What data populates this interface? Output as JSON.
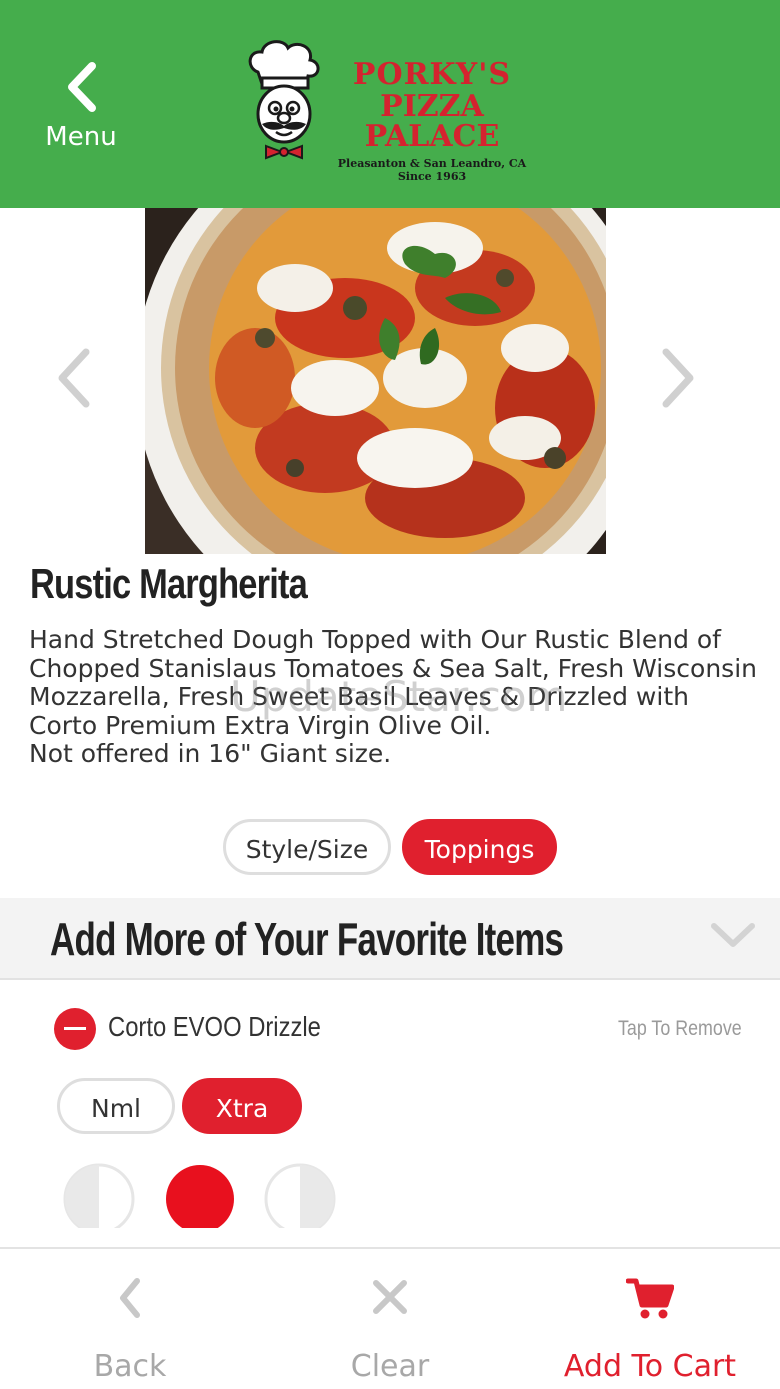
{
  "header": {
    "menu_label": "Menu",
    "logo": {
      "line1": "PORKY'S",
      "line2": "PIZZA PALACE",
      "line3": "Pleasanton & San Leandro, CA",
      "line4": "Since 1963"
    }
  },
  "item": {
    "title": "Rustic Margherita",
    "description": "Hand Stretched Dough Topped with Our Rustic Blend of Chopped Stanislaus Tomatoes & Sea Salt, Fresh Wisconsin Mozzarella, Fresh Sweet Basil Leaves & Drizzled with Corto Premium Extra Virgin Olive Oil.",
    "note": "Not offered in 16\" Giant size."
  },
  "watermark": "UpdateStar.com",
  "option_tabs": [
    {
      "label": "Style/Size",
      "active": false
    },
    {
      "label": "Toppings",
      "active": true
    }
  ],
  "section": {
    "title": "Add More of Your Favorite Items"
  },
  "topping": {
    "name": "Corto EVOO Drizzle",
    "action": "Tap To Remove",
    "amounts": [
      {
        "label": "Nml",
        "selected": false
      },
      {
        "label": "Xtra",
        "selected": true
      }
    ],
    "portions": [
      "left-half",
      "whole",
      "right-half"
    ],
    "selected_portion": "whole"
  },
  "bottom_bar": {
    "back_label": "Back",
    "clear_label": "Clear",
    "cart_label": "Add To Cart"
  },
  "colors": {
    "header_green": "#45ad4c",
    "accent_red": "#e0202e",
    "muted_gray": "#9a9a9a"
  }
}
